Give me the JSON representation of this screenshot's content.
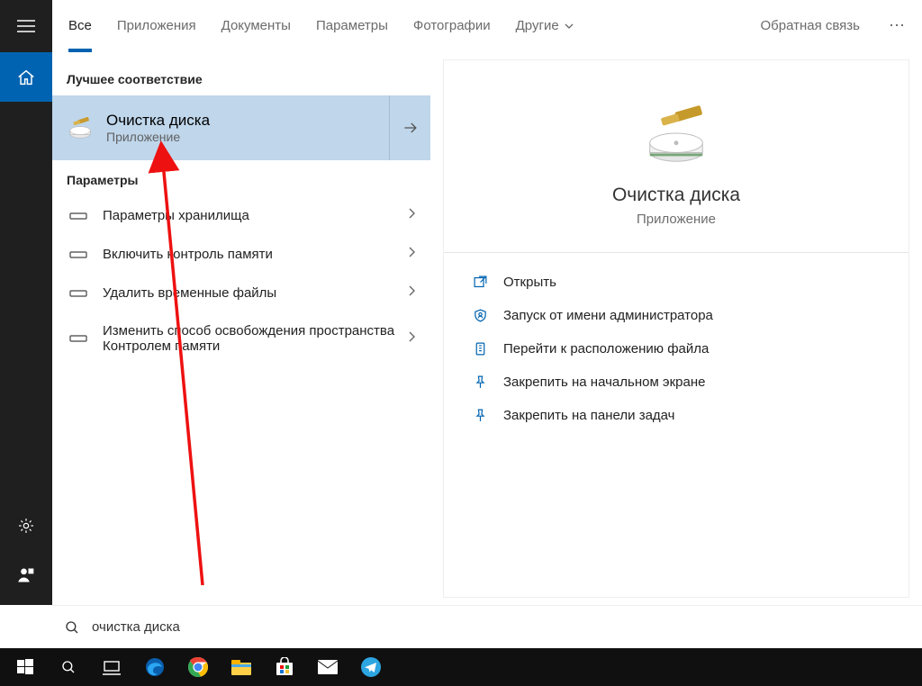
{
  "tabs": {
    "all": "Все",
    "apps": "Приложения",
    "docs": "Документы",
    "settings": "Параметры",
    "photos": "Фотографии",
    "other": "Другие"
  },
  "feedback_label": "Обратная связь",
  "group": {
    "best_match": "Лучшее соответствие",
    "settings": "Параметры"
  },
  "best_match": {
    "title": "Очистка диска",
    "subtitle": "Приложение"
  },
  "settings_items": [
    "Параметры хранилища",
    "Включить контроль памяти",
    "Удалить временные файлы",
    "Изменить способ освобождения пространства Контролем памяти"
  ],
  "preview": {
    "title": "Очистка диска",
    "subtitle": "Приложение"
  },
  "actions": [
    "Открыть",
    "Запуск от имени администратора",
    "Перейти к расположению файла",
    "Закрепить на начальном экране",
    "Закрепить на панели задач"
  ],
  "search": {
    "query": "очистка диска"
  }
}
